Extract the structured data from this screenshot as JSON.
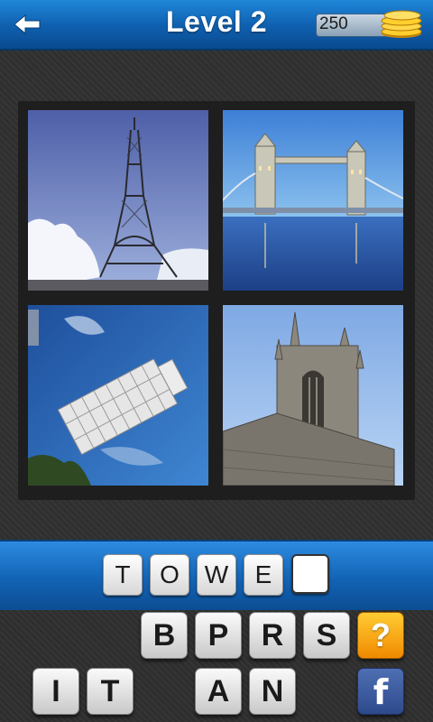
{
  "header": {
    "title": "Level 2",
    "coins": "250",
    "back_icon": "back-arrow-icon",
    "coin_icon": "gold-coins-icon"
  },
  "puzzle": {
    "images": [
      {
        "subject": "Eiffel Tower"
      },
      {
        "subject": "Tower Bridge"
      },
      {
        "subject": "Leaning Tower of Pisa"
      },
      {
        "subject": "Gothic church tower"
      }
    ]
  },
  "answer": {
    "letters": [
      "T",
      "O",
      "W",
      "E",
      ""
    ]
  },
  "pool": {
    "row1": [
      "B",
      "P",
      "R",
      "S"
    ],
    "row2": [
      "I",
      "T",
      "",
      "A",
      "N"
    ],
    "hint_label": "?",
    "share_label": "f"
  },
  "colors": {
    "header_blue": "#0f5fae",
    "hint_orange": "#f5a000",
    "facebook_blue": "#3b5998"
  }
}
